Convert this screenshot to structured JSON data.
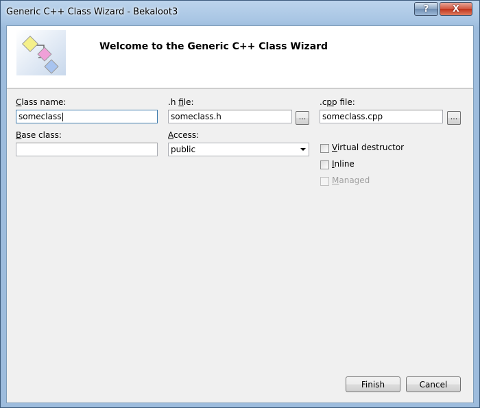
{
  "window": {
    "title": "Generic C++ Class Wizard - Bekaloot3",
    "help_label": "?",
    "close_label": "X"
  },
  "header": {
    "title": "Welcome to the Generic C++ Class Wizard"
  },
  "form": {
    "class_name": {
      "label_u": "C",
      "label_rest": "lass name:",
      "value": "someclass"
    },
    "h_file": {
      "label_pre": ".h ",
      "label_u": "f",
      "label_rest": "ile:",
      "value": "someclass.h",
      "browse_label": "..."
    },
    "cpp_file": {
      "label_pre": ".c",
      "label_u": "p",
      "label_rest": "p file:",
      "value": "someclass.cpp",
      "browse_label": "..."
    },
    "base_class": {
      "label_u": "B",
      "label_rest": "ase class:",
      "value": ""
    },
    "access": {
      "label_u": "A",
      "label_rest": "ccess:",
      "value": "public"
    },
    "virtual_destructor": {
      "label_u": "V",
      "label_rest": "irtual destructor",
      "checked": false
    },
    "inline": {
      "label_u": "I",
      "label_rest": "nline",
      "checked": false
    },
    "managed": {
      "label_u": "M",
      "label_rest": "anaged",
      "checked": false,
      "disabled": true
    }
  },
  "buttons": {
    "finish": "Finish",
    "cancel": "Cancel"
  },
  "colors": {
    "title_gradient_top": "#bcd4ec",
    "close_red": "#c0341c",
    "client_bg": "#f0f0f0"
  }
}
